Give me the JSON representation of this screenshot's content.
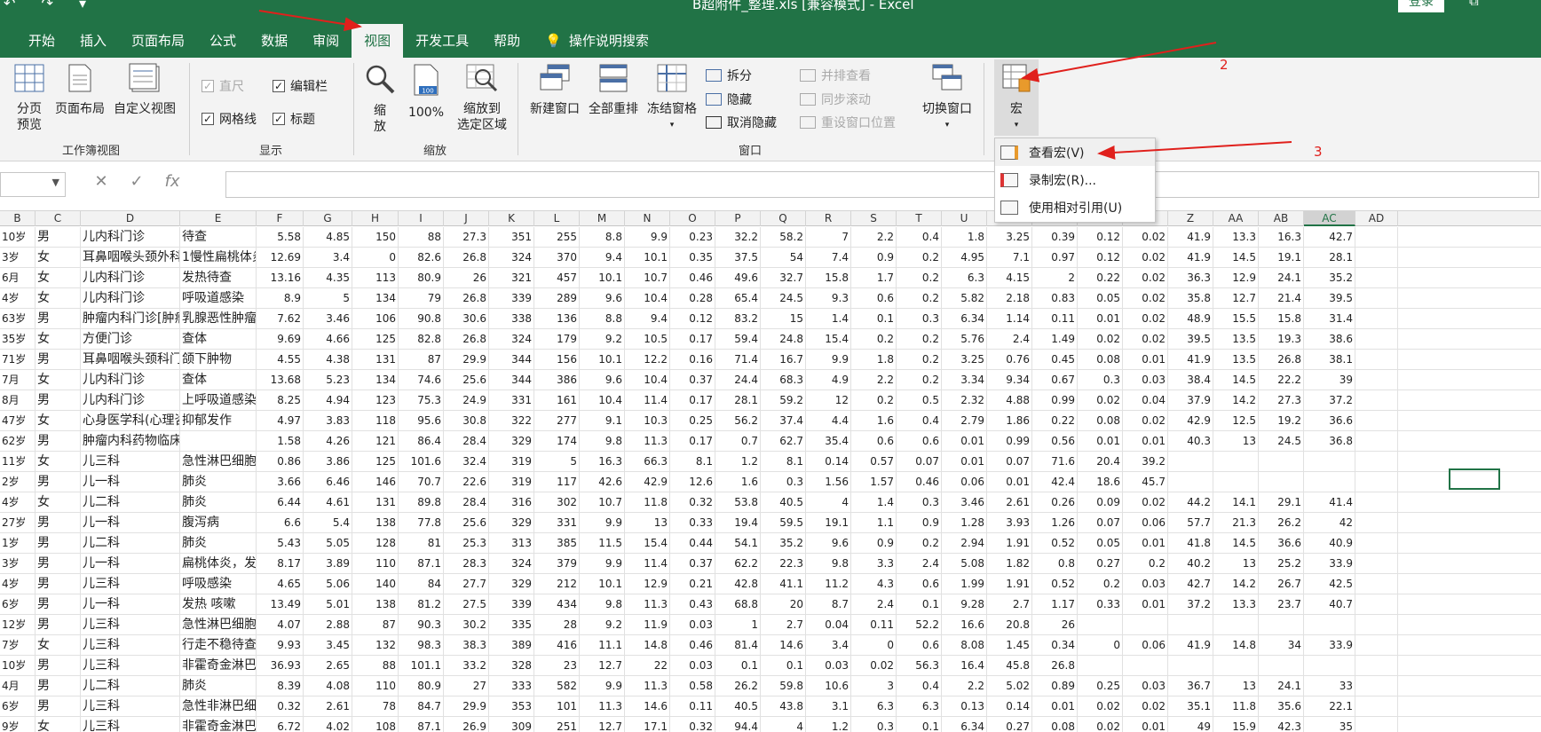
{
  "titlebar": {
    "title": "B超附件_整理.xls  [兼容模式]  -  Excel",
    "login": "登录",
    "qat": "↶ ↷ ▾",
    "win": "⧉"
  },
  "tabs": [
    {
      "label": "开始"
    },
    {
      "label": "插入"
    },
    {
      "label": "页面布局"
    },
    {
      "label": "公式"
    },
    {
      "label": "数据"
    },
    {
      "label": "审阅"
    },
    {
      "label": "视图",
      "active": true
    },
    {
      "label": "开发工具"
    },
    {
      "label": "帮助"
    },
    {
      "label": "操作说明搜索",
      "icon": "lightbulb-icon"
    }
  ],
  "ribbon": {
    "workbook_views": {
      "label": "工作簿视图",
      "page_break": "分页\n预览",
      "page_layout": "页面布局",
      "custom_view": "自定义视图"
    },
    "show": {
      "label": "显示",
      "ruler": "直尺",
      "formula_bar": "编辑栏",
      "gridlines": "网格线",
      "headings": "标题"
    },
    "zoom": {
      "label": "缩放",
      "zoom": "缩\n放",
      "zoom100": "100%",
      "zoom_sel": "缩放到\n选定区域",
      "zoom100_icon_text": "100"
    },
    "window": {
      "label": "窗口",
      "new_window": "新建窗口",
      "arrange_all": "全部重排",
      "freeze": "冻结窗格",
      "split": "拆分",
      "hide": "隐藏",
      "unhide": "取消隐藏",
      "side_by_side": "并排查看",
      "sync_scroll": "同步滚动",
      "reset_pos": "重设窗口位置",
      "switch": "切换窗口"
    },
    "macros": {
      "label": "宏"
    }
  },
  "macro_menu": [
    {
      "label": "查看宏(V)",
      "icon": "view-macros-icon"
    },
    {
      "label": "录制宏(R)...",
      "icon": "record-macro-icon"
    },
    {
      "label": "使用相对引用(U)",
      "icon": "relative-ref-icon"
    }
  ],
  "formula_bar": {
    "cancel": "✕",
    "enter": "✓",
    "fx": "fx"
  },
  "annotations": [
    "2",
    "3"
  ],
  "columns": [
    "B",
    "C",
    "D",
    "E",
    "F",
    "G",
    "H",
    "I",
    "J",
    "K",
    "L",
    "M",
    "N",
    "O",
    "P",
    "Q",
    "R",
    "S",
    "T",
    "U",
    "V",
    "W",
    "X",
    "Y",
    "Z",
    "AA",
    "AB",
    "AC",
    "AD"
  ],
  "rows": [
    [
      "10岁",
      "男",
      "儿内科门诊",
      "待查",
      "5.58",
      "4.85",
      "150",
      "88",
      "27.3",
      "351",
      "255",
      "8.8",
      "9.9",
      "0.23",
      "32.2",
      "58.2",
      "7",
      "2.2",
      "0.4",
      "1.8",
      "3.25",
      "0.39",
      "0.12",
      "0.02",
      "41.9",
      "13.3",
      "16.3",
      "42.7"
    ],
    [
      "3岁",
      "女",
      "耳鼻咽喉头颈外科",
      "1慢性扁桃体炎2",
      "12.69",
      "3.4",
      "0",
      "82.6",
      "26.8",
      "324",
      "370",
      "9.4",
      "10.1",
      "0.35",
      "37.5",
      "54",
      "7.4",
      "0.9",
      "0.2",
      "4.95",
      "7.1",
      "0.97",
      "0.12",
      "0.02",
      "41.9",
      "14.5",
      "19.1",
      "28.1"
    ],
    [
      "6月",
      "女",
      "儿内科门诊",
      "发热待查",
      "13.16",
      "4.35",
      "113",
      "80.9",
      "26",
      "321",
      "457",
      "10.1",
      "10.7",
      "0.46",
      "49.6",
      "32.7",
      "15.8",
      "1.7",
      "0.2",
      "6.3",
      "4.15",
      "2",
      "0.22",
      "0.02",
      "36.3",
      "12.9",
      "24.1",
      "35.2"
    ],
    [
      "4岁",
      "女",
      "儿内科门诊",
      "呼吸道感染",
      "8.9",
      "5",
      "134",
      "79",
      "26.8",
      "339",
      "289",
      "9.6",
      "10.4",
      "0.28",
      "65.4",
      "24.5",
      "9.3",
      "0.6",
      "0.2",
      "5.82",
      "2.18",
      "0.83",
      "0.05",
      "0.02",
      "35.8",
      "12.7",
      "21.4",
      "39.5"
    ],
    [
      "63岁",
      "男",
      "肿瘤内科门诊[肿瘤",
      "乳腺恶性肿瘤",
      "7.62",
      "3.46",
      "106",
      "90.8",
      "30.6",
      "338",
      "136",
      "8.8",
      "9.4",
      "0.12",
      "83.2",
      "15",
      "1.4",
      "0.1",
      "0.3",
      "6.34",
      "1.14",
      "0.11",
      "0.01",
      "0.02",
      "48.9",
      "15.5",
      "15.8",
      "31.4"
    ],
    [
      "35岁",
      "女",
      "方便门诊",
      "查体",
      "9.69",
      "4.66",
      "125",
      "82.8",
      "26.8",
      "324",
      "179",
      "9.2",
      "10.5",
      "0.17",
      "59.4",
      "24.8",
      "15.4",
      "0.2",
      "0.2",
      "5.76",
      "2.4",
      "1.49",
      "0.02",
      "0.02",
      "39.5",
      "13.5",
      "19.3",
      "38.6"
    ],
    [
      "71岁",
      "男",
      "耳鼻咽喉头颈科门",
      "颌下肿物",
      "4.55",
      "4.38",
      "131",
      "87",
      "29.9",
      "344",
      "156",
      "10.1",
      "12.2",
      "0.16",
      "71.4",
      "16.7",
      "9.9",
      "1.8",
      "0.2",
      "3.25",
      "0.76",
      "0.45",
      "0.08",
      "0.01",
      "41.9",
      "13.5",
      "26.8",
      "38.1"
    ],
    [
      "7月",
      "女",
      "儿内科门诊",
      "查体",
      "13.68",
      "5.23",
      "134",
      "74.6",
      "25.6",
      "344",
      "386",
      "9.6",
      "10.4",
      "0.37",
      "24.4",
      "68.3",
      "4.9",
      "2.2",
      "0.2",
      "3.34",
      "9.34",
      "0.67",
      "0.3",
      "0.03",
      "38.4",
      "14.5",
      "22.2",
      "39"
    ],
    [
      "8月",
      "男",
      "儿内科门诊",
      "上呼吸道感染",
      "8.25",
      "4.94",
      "123",
      "75.3",
      "24.9",
      "331",
      "161",
      "10.4",
      "11.4",
      "0.17",
      "28.1",
      "59.2",
      "12",
      "0.2",
      "0.5",
      "2.32",
      "4.88",
      "0.99",
      "0.02",
      "0.04",
      "37.9",
      "14.2",
      "27.3",
      "37.2"
    ],
    [
      "47岁",
      "女",
      "心身医学科(心理咨",
      "抑郁发作",
      "4.97",
      "3.83",
      "118",
      "95.6",
      "30.8",
      "322",
      "277",
      "9.1",
      "10.3",
      "0.25",
      "56.2",
      "37.4",
      "4.4",
      "1.6",
      "0.4",
      "2.79",
      "1.86",
      "0.22",
      "0.08",
      "0.02",
      "42.9",
      "12.5",
      "19.2",
      "36.6"
    ],
    [
      "62岁",
      "男",
      "肿瘤内科药物临床实验",
      "",
      "1.58",
      "4.26",
      "121",
      "86.4",
      "28.4",
      "329",
      "174",
      "9.8",
      "11.3",
      "0.17",
      "0.7",
      "62.7",
      "35.4",
      "0.6",
      "0.6",
      "0.01",
      "0.99",
      "0.56",
      "0.01",
      "0.01",
      "40.3",
      "13",
      "24.5",
      "36.8"
    ],
    [
      "11岁",
      "女",
      "儿三科",
      "急性淋巴细胞",
      "0.86",
      "3.86",
      "125",
      "101.6",
      "32.4",
      "319",
      "5",
      "16.3",
      "66.3",
      "8.1",
      "1.2",
      "8.1",
      "0.14",
      "0.57",
      "0.07",
      "0.01",
      "0.07",
      "71.6",
      "20.4",
      "39.2",
      "",
      "",
      "",
      ""
    ],
    [
      "2岁",
      "男",
      "儿一科",
      "肺炎",
      "3.66",
      "6.46",
      "146",
      "70.7",
      "22.6",
      "319",
      "117",
      "42.6",
      "42.9",
      "12.6",
      "1.6",
      "0.3",
      "1.56",
      "1.57",
      "0.46",
      "0.06",
      "0.01",
      "42.4",
      "18.6",
      "45.7",
      "",
      "",
      "",
      ""
    ],
    [
      "4岁",
      "女",
      "儿二科",
      "肺炎",
      "6.44",
      "4.61",
      "131",
      "89.8",
      "28.4",
      "316",
      "302",
      "10.7",
      "11.8",
      "0.32",
      "53.8",
      "40.5",
      "4",
      "1.4",
      "0.3",
      "3.46",
      "2.61",
      "0.26",
      "0.09",
      "0.02",
      "44.2",
      "14.1",
      "29.1",
      "41.4"
    ],
    [
      "27岁",
      "男",
      "儿一科",
      "腹泻病",
      "6.6",
      "5.4",
      "138",
      "77.8",
      "25.6",
      "329",
      "331",
      "9.9",
      "13",
      "0.33",
      "19.4",
      "59.5",
      "19.1",
      "1.1",
      "0.9",
      "1.28",
      "3.93",
      "1.26",
      "0.07",
      "0.06",
      "57.7",
      "21.3",
      "26.2",
      "42"
    ],
    [
      "1岁",
      "男",
      "儿二科",
      "肺炎",
      "5.43",
      "5.05",
      "128",
      "81",
      "25.3",
      "313",
      "385",
      "11.5",
      "15.4",
      "0.44",
      "54.1",
      "35.2",
      "9.6",
      "0.9",
      "0.2",
      "2.94",
      "1.91",
      "0.52",
      "0.05",
      "0.01",
      "41.8",
      "14.5",
      "36.6",
      "40.9"
    ],
    [
      "3岁",
      "男",
      "儿一科",
      "扁桃体炎，发",
      "8.17",
      "3.89",
      "110",
      "87.1",
      "28.3",
      "324",
      "379",
      "9.9",
      "11.4",
      "0.37",
      "62.2",
      "22.3",
      "9.8",
      "3.3",
      "2.4",
      "5.08",
      "1.82",
      "0.8",
      "0.27",
      "0.2",
      "40.2",
      "13",
      "25.2",
      "33.9"
    ],
    [
      "4岁",
      "男",
      "儿三科",
      "呼吸感染",
      "4.65",
      "5.06",
      "140",
      "84",
      "27.7",
      "329",
      "212",
      "10.1",
      "12.9",
      "0.21",
      "42.8",
      "41.1",
      "11.2",
      "4.3",
      "0.6",
      "1.99",
      "1.91",
      "0.52",
      "0.2",
      "0.03",
      "42.7",
      "14.2",
      "26.7",
      "42.5"
    ],
    [
      "6岁",
      "男",
      "儿一科",
      "发热 咳嗽",
      "13.49",
      "5.01",
      "138",
      "81.2",
      "27.5",
      "339",
      "434",
      "9.8",
      "11.3",
      "0.43",
      "68.8",
      "20",
      "8.7",
      "2.4",
      "0.1",
      "9.28",
      "2.7",
      "1.17",
      "0.33",
      "0.01",
      "37.2",
      "13.3",
      "23.7",
      "40.7"
    ],
    [
      "12岁",
      "男",
      "儿三科",
      "急性淋巴细胞",
      "4.07",
      "2.88",
      "87",
      "90.3",
      "30.2",
      "335",
      "28",
      "9.2",
      "11.9",
      "0.03",
      "1",
      "2.7",
      "0.04",
      "0.11",
      "52.2",
      "16.6",
      "20.8",
      "26",
      "",
      "",
      "",
      "",
      "",
      ""
    ],
    [
      "7岁",
      "女",
      "儿三科",
      "行走不稳待查",
      "9.93",
      "3.45",
      "132",
      "98.3",
      "38.3",
      "389",
      "416",
      "11.1",
      "14.8",
      "0.46",
      "81.4",
      "14.6",
      "3.4",
      "0",
      "0.6",
      "8.08",
      "1.45",
      "0.34",
      "0",
      "0.06",
      "41.9",
      "14.8",
      "34",
      "33.9"
    ],
    [
      "10岁",
      "男",
      "儿三科",
      "非霍奇金淋巴",
      "36.93",
      "2.65",
      "88",
      "101.1",
      "33.2",
      "328",
      "23",
      "12.7",
      "22",
      "0.03",
      "0.1",
      "0.1",
      "0.03",
      "0.02",
      "56.3",
      "16.4",
      "45.8",
      "26.8",
      "",
      "",
      "",
      "",
      "",
      ""
    ],
    [
      "4月",
      "男",
      "儿二科",
      "肺炎",
      "8.39",
      "4.08",
      "110",
      "80.9",
      "27",
      "333",
      "582",
      "9.9",
      "11.3",
      "0.58",
      "26.2",
      "59.8",
      "10.6",
      "3",
      "0.4",
      "2.2",
      "5.02",
      "0.89",
      "0.25",
      "0.03",
      "36.7",
      "13",
      "24.1",
      "33"
    ],
    [
      "6岁",
      "男",
      "儿三科",
      "急性非淋巴细",
      "0.32",
      "2.61",
      "78",
      "84.7",
      "29.9",
      "353",
      "101",
      "11.3",
      "14.6",
      "0.11",
      "40.5",
      "43.8",
      "3.1",
      "6.3",
      "6.3",
      "0.13",
      "0.14",
      "0.01",
      "0.02",
      "0.02",
      "35.1",
      "11.8",
      "35.6",
      "22.1"
    ],
    [
      "9岁",
      "女",
      "儿三科",
      "非霍奇金淋巴",
      "6.72",
      "4.02",
      "108",
      "87.1",
      "26.9",
      "309",
      "251",
      "12.7",
      "17.1",
      "0.32",
      "94.4",
      "4",
      "1.2",
      "0.3",
      "0.1",
      "6.34",
      "0.27",
      "0.08",
      "0.02",
      "0.01",
      "49",
      "15.9",
      "42.3",
      "35"
    ]
  ]
}
